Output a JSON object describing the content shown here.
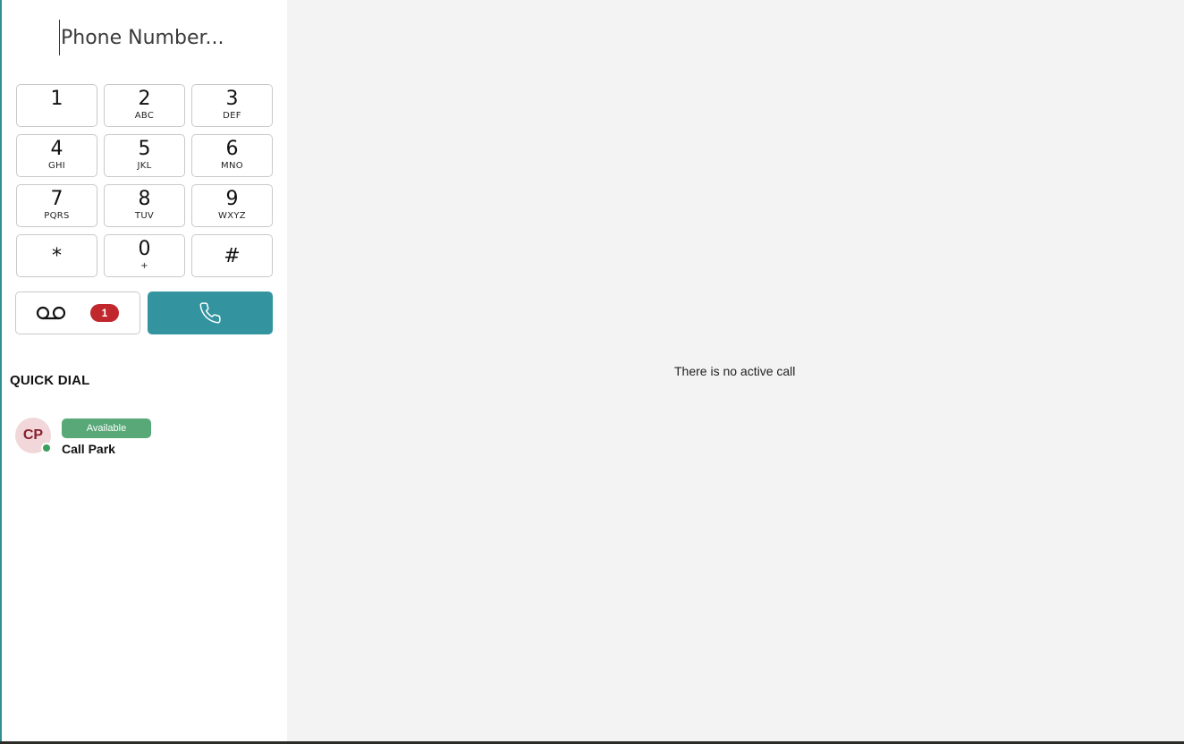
{
  "dialer": {
    "placeholder": "Phone Number...",
    "keys": [
      {
        "digit": "1",
        "letters": ""
      },
      {
        "digit": "2",
        "letters": "ABC"
      },
      {
        "digit": "3",
        "letters": "DEF"
      },
      {
        "digit": "4",
        "letters": "GHI"
      },
      {
        "digit": "5",
        "letters": "JKL"
      },
      {
        "digit": "6",
        "letters": "MNO"
      },
      {
        "digit": "7",
        "letters": "PQRS"
      },
      {
        "digit": "8",
        "letters": "TUV"
      },
      {
        "digit": "9",
        "letters": "WXYZ"
      },
      {
        "digit": "*",
        "letters": ""
      },
      {
        "digit": "0",
        "letters": "+"
      },
      {
        "digit": "#",
        "letters": ""
      }
    ],
    "voicemail": {
      "icon": "voicemail-icon",
      "badge_count": "1"
    },
    "call": {
      "icon": "phone-icon",
      "color": "#3394a0"
    }
  },
  "quick_dial": {
    "title": "QUICK DIAL",
    "contacts": [
      {
        "initials": "CP",
        "status": "Available",
        "name": "Call Park",
        "status_color": "#58a878"
      }
    ]
  },
  "main": {
    "empty_message": "There is no active call"
  }
}
